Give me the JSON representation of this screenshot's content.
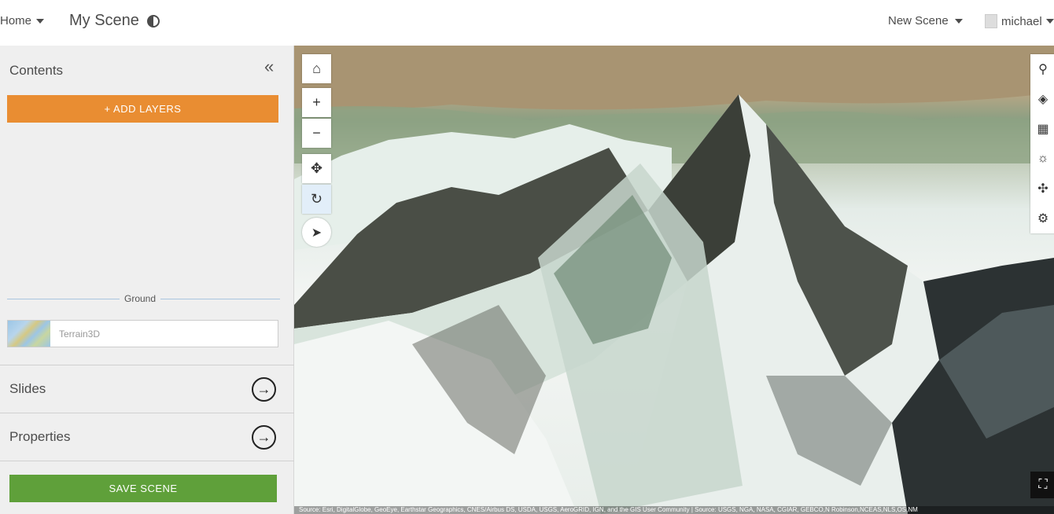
{
  "header": {
    "home_label": "Home",
    "scene_title": "My Scene",
    "new_scene_label": "New Scene",
    "user_name": "michael"
  },
  "sidebar": {
    "contents_title": "Contents",
    "add_layers_label": "+ ADD LAYERS",
    "ground_label": "Ground",
    "terrain_label": "Terrain3D",
    "slides_label": "Slides",
    "properties_label": "Properties",
    "save_label": "SAVE SCENE"
  },
  "scene": {
    "nav_tools": [
      "home-icon",
      "zoom-in-icon",
      "zoom-out-icon",
      "pan-icon",
      "rotate-icon"
    ],
    "compass": "compass-icon",
    "right_tools": [
      "search-icon",
      "layers-icon",
      "basemap-gallery-icon",
      "daylight-icon",
      "navigation-icon",
      "settings-icon"
    ],
    "attribution": "Source: Esri, DigitalGlobe, GeoEye, Earthstar Geographics, CNES/Airbus DS, USDA, USGS, AeroGRID, IGN, and the GIS User Community | Source: USGS, NGA, NASA, CGIAR, GEBCO,N Robinson,NCEAS,NLS,OS,NM",
    "colors": {
      "add_layers": "#e98d32",
      "save": "#5fa03a",
      "active_tool": "#e2eef9"
    }
  }
}
